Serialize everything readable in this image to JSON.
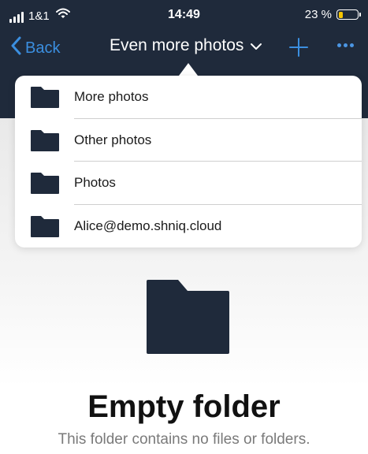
{
  "status_bar": {
    "carrier": "1&1",
    "time": "14:49",
    "battery_text": "23 %",
    "battery_level": 0.23,
    "battery_color": "#f5c400"
  },
  "nav": {
    "back_label": "Back",
    "title": "Even more photos",
    "title_icon": "chevron-down-icon",
    "add_icon": "plus-icon",
    "more_icon": "more-dots-icon",
    "accent_color": "#3b8fe0"
  },
  "popover": {
    "items": [
      {
        "label": "More photos",
        "icon": "folder-icon"
      },
      {
        "label": "Other photos",
        "icon": "folder-icon"
      },
      {
        "label": "Photos",
        "icon": "folder-icon"
      },
      {
        "label": "Alice@demo.shniq.cloud",
        "icon": "folder-icon"
      }
    ]
  },
  "empty_state": {
    "icon": "folder-icon",
    "title": "Empty folder",
    "subtitle": "This folder contains no files or folders."
  },
  "colors": {
    "header_bg": "#1f2a3b",
    "folder": "#1f2a3b"
  }
}
